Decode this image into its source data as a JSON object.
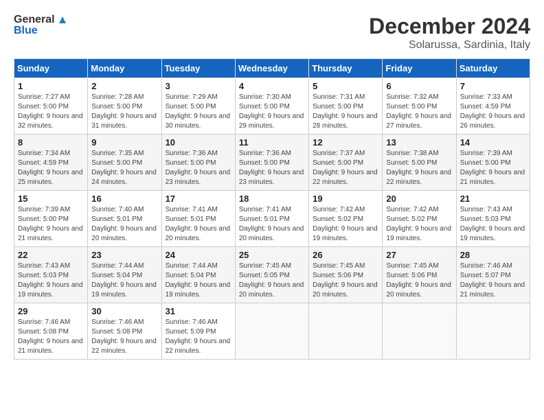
{
  "header": {
    "logo_text_general": "General",
    "logo_text_blue": "Blue",
    "month_year": "December 2024",
    "location": "Solarussa, Sardinia, Italy"
  },
  "calendar": {
    "days_of_week": [
      "Sunday",
      "Monday",
      "Tuesday",
      "Wednesday",
      "Thursday",
      "Friday",
      "Saturday"
    ],
    "weeks": [
      [
        null,
        {
          "day": "2",
          "sunrise": "7:28 AM",
          "sunset": "5:00 PM",
          "daylight": "9 hours and 31 minutes."
        },
        {
          "day": "3",
          "sunrise": "7:29 AM",
          "sunset": "5:00 PM",
          "daylight": "9 hours and 30 minutes."
        },
        {
          "day": "4",
          "sunrise": "7:30 AM",
          "sunset": "5:00 PM",
          "daylight": "9 hours and 29 minutes."
        },
        {
          "day": "5",
          "sunrise": "7:31 AM",
          "sunset": "5:00 PM",
          "daylight": "9 hours and 28 minutes."
        },
        {
          "day": "6",
          "sunrise": "7:32 AM",
          "sunset": "5:00 PM",
          "daylight": "9 hours and 27 minutes."
        },
        {
          "day": "7",
          "sunrise": "7:33 AM",
          "sunset": "4:59 PM",
          "daylight": "9 hours and 26 minutes."
        }
      ],
      [
        {
          "day": "1",
          "sunrise": "7:27 AM",
          "sunset": "5:00 PM",
          "daylight": "9 hours and 32 minutes."
        },
        null,
        null,
        null,
        null,
        null,
        null
      ],
      [
        {
          "day": "8",
          "sunrise": "7:34 AM",
          "sunset": "4:59 PM",
          "daylight": "9 hours and 25 minutes."
        },
        {
          "day": "9",
          "sunrise": "7:35 AM",
          "sunset": "5:00 PM",
          "daylight": "9 hours and 24 minutes."
        },
        {
          "day": "10",
          "sunrise": "7:36 AM",
          "sunset": "5:00 PM",
          "daylight": "9 hours and 23 minutes."
        },
        {
          "day": "11",
          "sunrise": "7:36 AM",
          "sunset": "5:00 PM",
          "daylight": "9 hours and 23 minutes."
        },
        {
          "day": "12",
          "sunrise": "7:37 AM",
          "sunset": "5:00 PM",
          "daylight": "9 hours and 22 minutes."
        },
        {
          "day": "13",
          "sunrise": "7:38 AM",
          "sunset": "5:00 PM",
          "daylight": "9 hours and 22 minutes."
        },
        {
          "day": "14",
          "sunrise": "7:39 AM",
          "sunset": "5:00 PM",
          "daylight": "9 hours and 21 minutes."
        }
      ],
      [
        {
          "day": "15",
          "sunrise": "7:39 AM",
          "sunset": "5:00 PM",
          "daylight": "9 hours and 21 minutes."
        },
        {
          "day": "16",
          "sunrise": "7:40 AM",
          "sunset": "5:01 PM",
          "daylight": "9 hours and 20 minutes."
        },
        {
          "day": "17",
          "sunrise": "7:41 AM",
          "sunset": "5:01 PM",
          "daylight": "9 hours and 20 minutes."
        },
        {
          "day": "18",
          "sunrise": "7:41 AM",
          "sunset": "5:01 PM",
          "daylight": "9 hours and 20 minutes."
        },
        {
          "day": "19",
          "sunrise": "7:42 AM",
          "sunset": "5:02 PM",
          "daylight": "9 hours and 19 minutes."
        },
        {
          "day": "20",
          "sunrise": "7:42 AM",
          "sunset": "5:02 PM",
          "daylight": "9 hours and 19 minutes."
        },
        {
          "day": "21",
          "sunrise": "7:43 AM",
          "sunset": "5:03 PM",
          "daylight": "9 hours and 19 minutes."
        }
      ],
      [
        {
          "day": "22",
          "sunrise": "7:43 AM",
          "sunset": "5:03 PM",
          "daylight": "9 hours and 19 minutes."
        },
        {
          "day": "23",
          "sunrise": "7:44 AM",
          "sunset": "5:04 PM",
          "daylight": "9 hours and 19 minutes."
        },
        {
          "day": "24",
          "sunrise": "7:44 AM",
          "sunset": "5:04 PM",
          "daylight": "9 hours and 19 minutes."
        },
        {
          "day": "25",
          "sunrise": "7:45 AM",
          "sunset": "5:05 PM",
          "daylight": "9 hours and 20 minutes."
        },
        {
          "day": "26",
          "sunrise": "7:45 AM",
          "sunset": "5:06 PM",
          "daylight": "9 hours and 20 minutes."
        },
        {
          "day": "27",
          "sunrise": "7:45 AM",
          "sunset": "5:06 PM",
          "daylight": "9 hours and 20 minutes."
        },
        {
          "day": "28",
          "sunrise": "7:46 AM",
          "sunset": "5:07 PM",
          "daylight": "9 hours and 21 minutes."
        }
      ],
      [
        {
          "day": "29",
          "sunrise": "7:46 AM",
          "sunset": "5:08 PM",
          "daylight": "9 hours and 21 minutes."
        },
        {
          "day": "30",
          "sunrise": "7:46 AM",
          "sunset": "5:08 PM",
          "daylight": "9 hours and 22 minutes."
        },
        {
          "day": "31",
          "sunrise": "7:46 AM",
          "sunset": "5:09 PM",
          "daylight": "9 hours and 22 minutes."
        },
        null,
        null,
        null,
        null
      ]
    ]
  }
}
